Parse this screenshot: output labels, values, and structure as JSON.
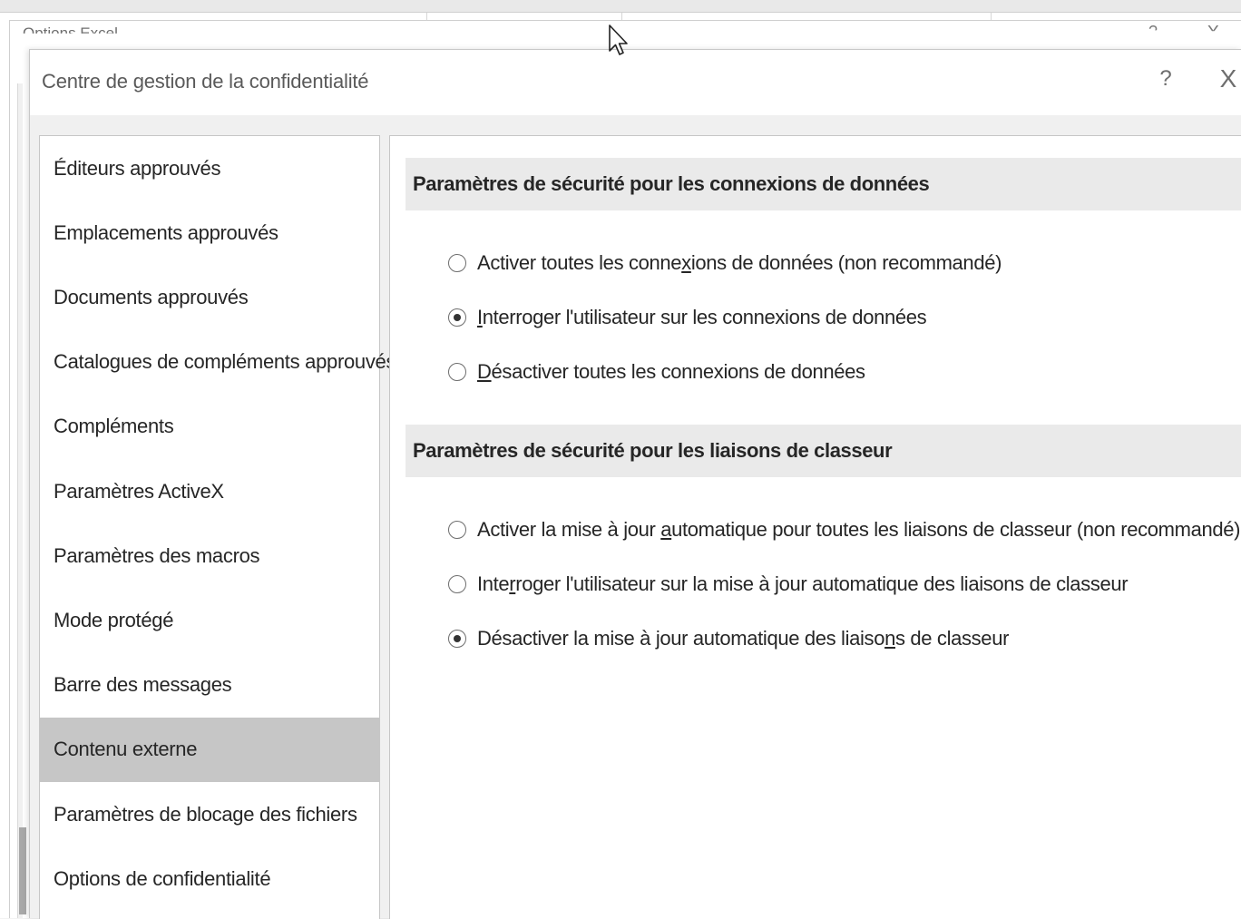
{
  "background_window": {
    "title": "Options Excel",
    "help": "?",
    "close": "X"
  },
  "dialog": {
    "title": "Centre de gestion de la confidentialité",
    "help": "?",
    "close": "X"
  },
  "nav": {
    "selected_index": 9,
    "items": [
      {
        "label": "Éditeurs approuvés"
      },
      {
        "label": "Emplacements approuvés"
      },
      {
        "label": "Documents approuvés"
      },
      {
        "label": "Catalogues de compléments approuvés"
      },
      {
        "label": "Compléments"
      },
      {
        "label": "Paramètres ActiveX"
      },
      {
        "label": "Paramètres des macros"
      },
      {
        "label": "Mode protégé"
      },
      {
        "label": "Barre des messages"
      },
      {
        "label": "Contenu externe"
      },
      {
        "label": "Paramètres de blocage des fichiers"
      },
      {
        "label": "Options de confidentialité"
      }
    ]
  },
  "sections": [
    {
      "header": "Paramètres de sécurité pour les connexions de données",
      "options": [
        {
          "before": "Activer toutes les conne",
          "accel": "x",
          "after": "ions de données (non recommandé)",
          "checked": false
        },
        {
          "before": "",
          "accel": "I",
          "after": "nterroger l'utilisateur sur les connexions de données",
          "checked": true
        },
        {
          "before": "",
          "accel": "D",
          "after": "ésactiver toutes les connexions de données",
          "checked": false
        }
      ]
    },
    {
      "header": "Paramètres de sécurité pour les liaisons de classeur",
      "options": [
        {
          "before": "Activer la mise à jour ",
          "accel": "a",
          "after": "utomatique pour toutes les liaisons de classeur (non recommandé)",
          "checked": false
        },
        {
          "before": "Inte",
          "accel": "r",
          "after": "roger l'utilisateur sur la mise à jour automatique des liaisons de classeur",
          "checked": false
        },
        {
          "before": "Désactiver la mise à jour automatique des liaiso",
          "accel": "n",
          "after": "s de classeur",
          "checked": true
        }
      ]
    }
  ]
}
